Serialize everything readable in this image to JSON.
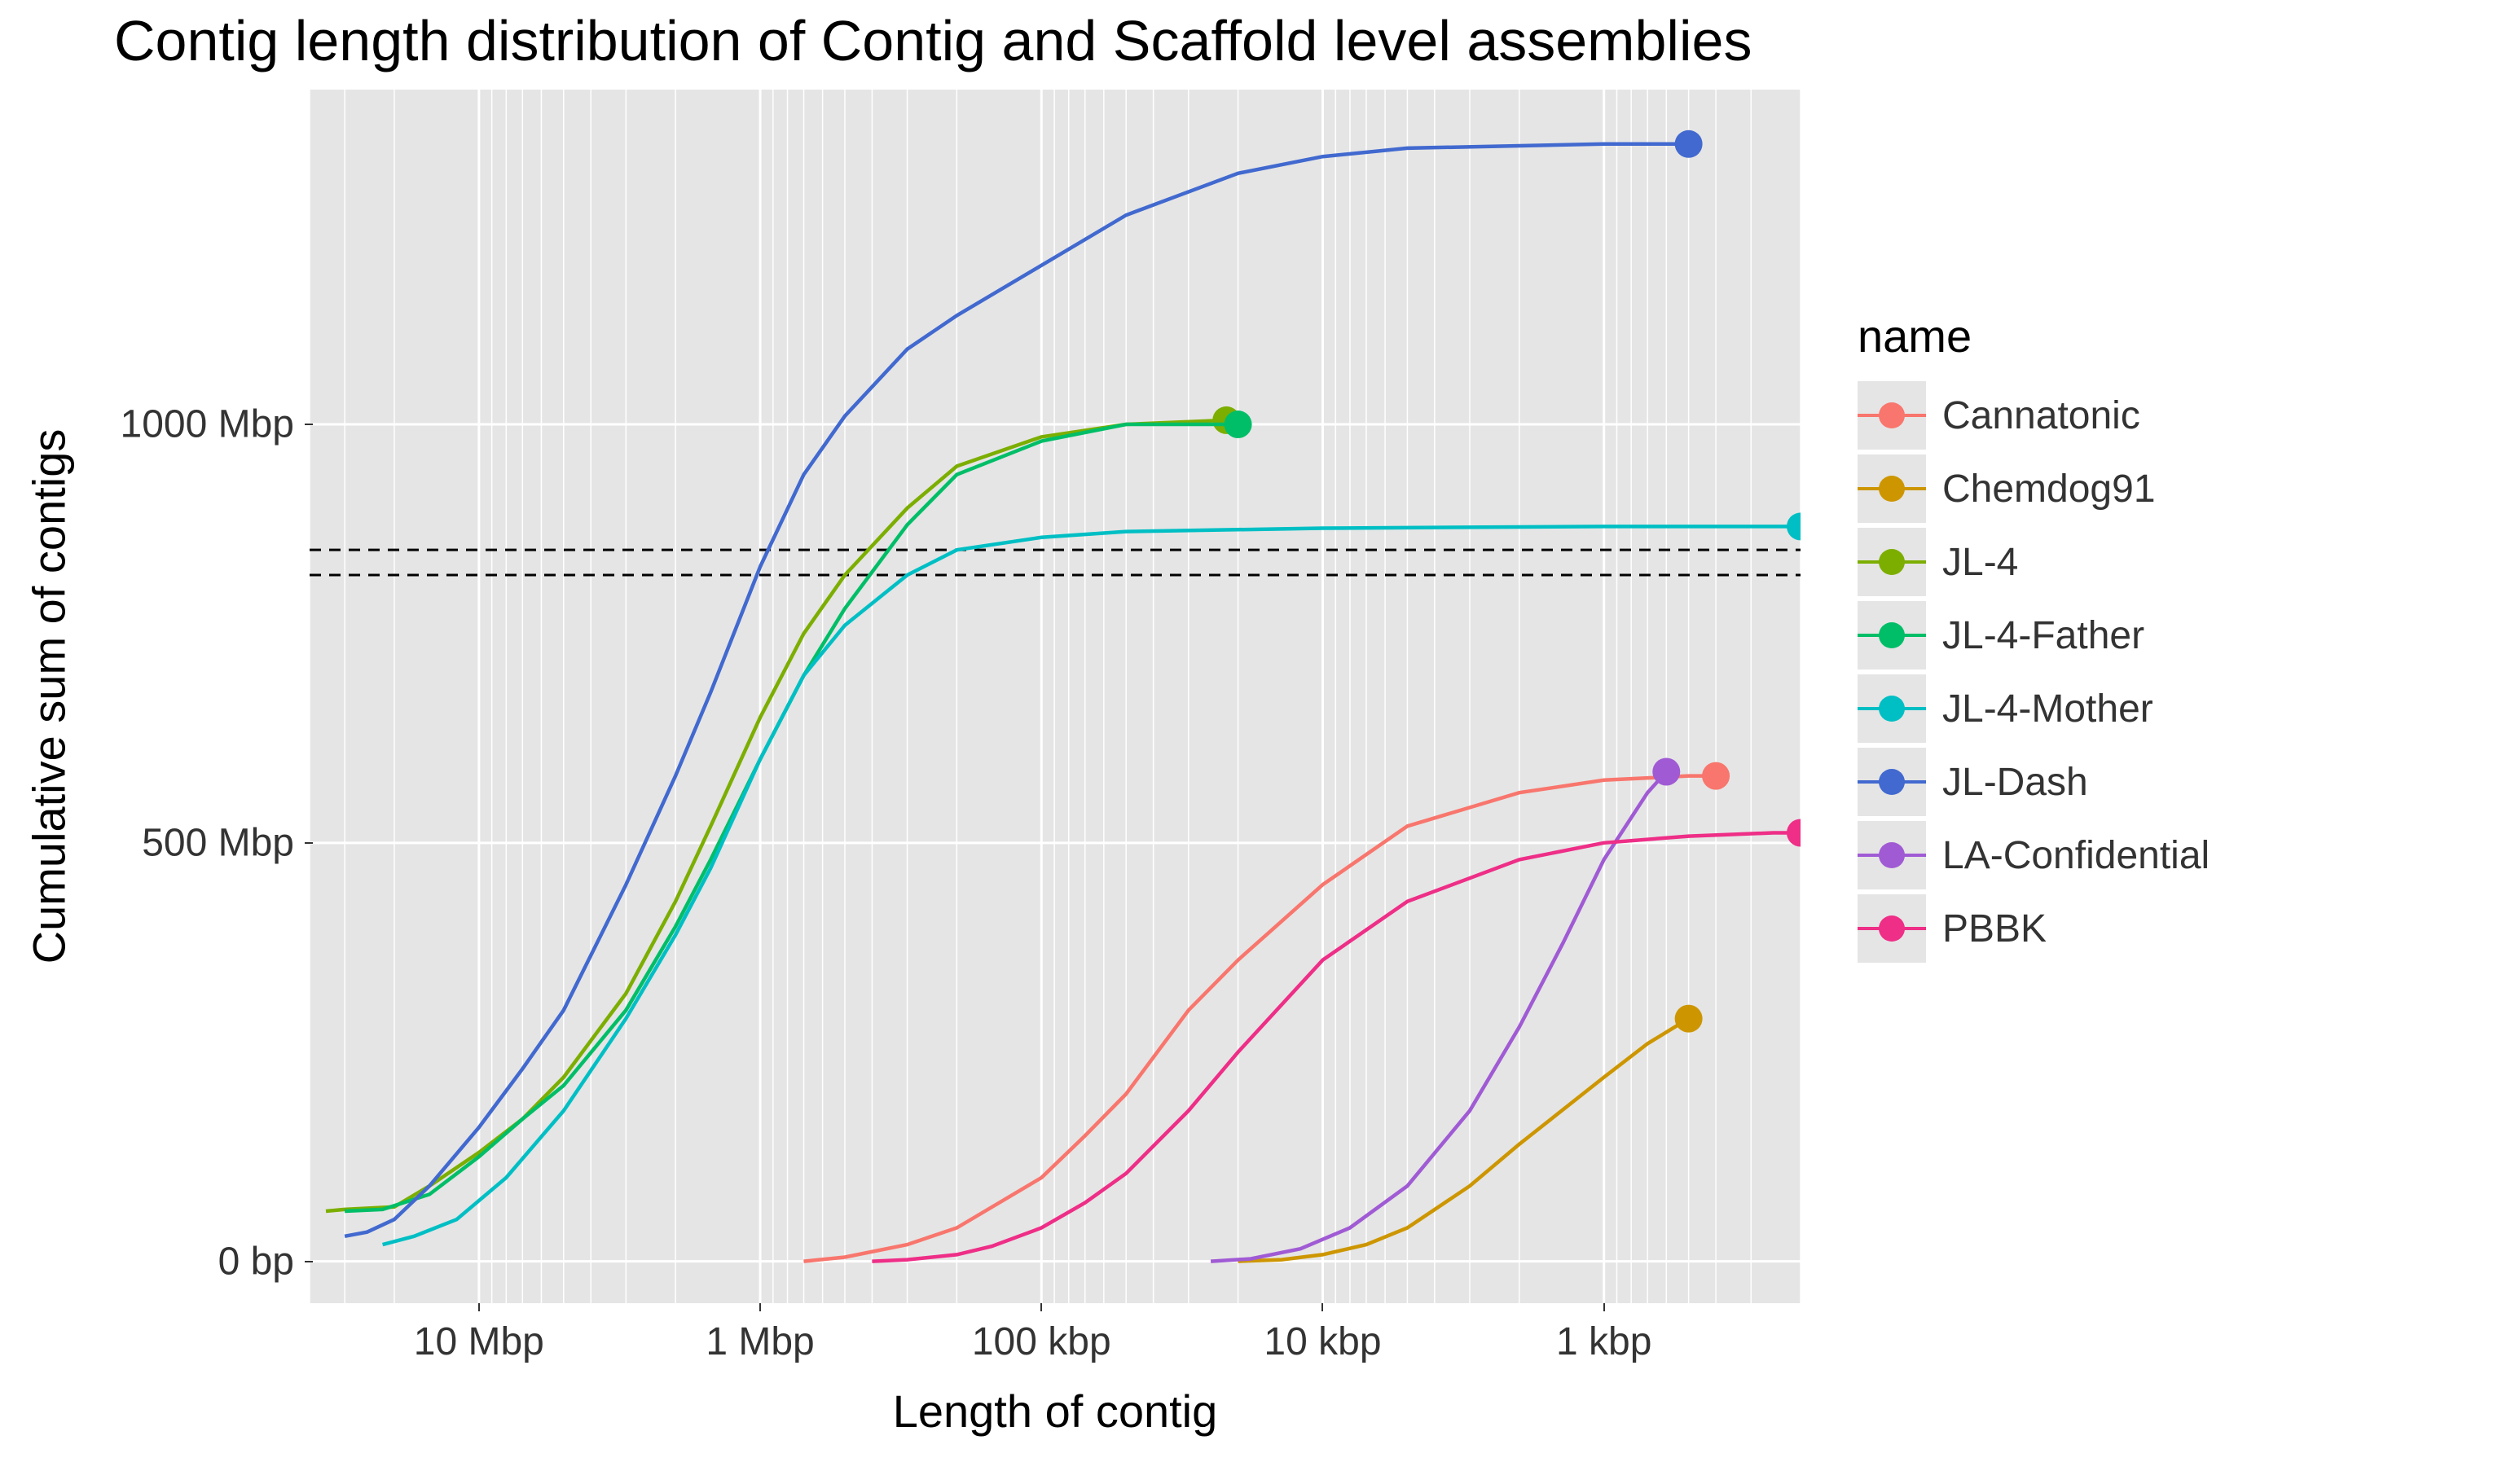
{
  "chart_data": {
    "type": "line",
    "title": "Contig length distribution of Contig and Scaffold level assemblies",
    "xlabel": "Length of contig",
    "ylabel": "Cumulative sum of contigs",
    "x_axis": {
      "scale": "log10_reversed",
      "ticks": [
        "10 Mbp",
        "1 Mbp",
        "100 kbp",
        "10 kbp",
        "1 kbp"
      ],
      "tick_values_bp": [
        10000000.0,
        1000000.0,
        100000.0,
        10000.0,
        1000.0
      ],
      "range_bp": [
        40000000.0,
        200
      ]
    },
    "y_axis": {
      "ticks": [
        "0 bp",
        "500 Mbp",
        "1000 Mbp"
      ],
      "tick_values_bp": [
        0,
        500000000.0,
        1000000000.0
      ],
      "range_bp": [
        -50000000.0,
        1400000000.0
      ]
    },
    "hlines_bp": [
      820000000.0,
      850000000.0
    ],
    "legend_title": "name",
    "series": [
      {
        "name": "Cannatonic",
        "color": "#f8766d",
        "end_dot": true,
        "x_bp": [
          700000.0,
          500000.0,
          300000.0,
          200000.0,
          100000.0,
          70000.0,
          50000.0,
          30000.0,
          20000.0,
          10000.0,
          5000.0,
          2000.0,
          1000.0,
          500,
          400
        ],
        "y_bp": [
          0,
          5000000.0,
          20000000.0,
          40000000.0,
          100000000.0,
          150000000.0,
          200000000.0,
          300000000.0,
          360000000.0,
          450000000.0,
          520000000.0,
          560000000.0,
          575000000.0,
          580000000.0,
          580000000.0
        ]
      },
      {
        "name": "Chemdog91",
        "color": "#cd9600",
        "end_dot": true,
        "x_bp": [
          20000.0,
          14000.0,
          10000.0,
          7000.0,
          5000.0,
          3000.0,
          2000.0,
          1000.0,
          700,
          500
        ],
        "y_bp": [
          0,
          2000000.0,
          8000000.0,
          20000000.0,
          40000000.0,
          90000000.0,
          140000000.0,
          220000000.0,
          260000000.0,
          290000000.0
        ]
      },
      {
        "name": "JL-4",
        "color": "#7cae00",
        "end_dot": true,
        "x_bp": [
          35000000.0,
          30000000.0,
          20000000.0,
          15000000.0,
          10000000.0,
          7000000.0,
          5000000.0,
          3000000.0,
          2000000.0,
          1500000.0,
          1000000.0,
          700000.0,
          500000.0,
          300000.0,
          200000.0,
          100000.0,
          50000.0,
          22000.0
        ],
        "y_bp": [
          60000000.0,
          62000000.0,
          65000000.0,
          90000000.0,
          130000000.0,
          170000000.0,
          220000000.0,
          320000000.0,
          430000000.0,
          520000000.0,
          650000000.0,
          750000000.0,
          820000000.0,
          900000000.0,
          950000000.0,
          985000000.0,
          1000000000.0,
          1005000000.0
        ]
      },
      {
        "name": "JL-4-Father",
        "color": "#00be67",
        "end_dot": true,
        "x_bp": [
          30000000.0,
          22000000.0,
          15000000.0,
          10000000.0,
          7000000.0,
          5000000.0,
          3000000.0,
          2000000.0,
          1500000.0,
          1000000.0,
          700000.0,
          500000.0,
          300000.0,
          200000.0,
          100000.0,
          50000.0,
          20000.0
        ],
        "y_bp": [
          60000000.0,
          62000000.0,
          80000000.0,
          125000000.0,
          170000000.0,
          210000000.0,
          300000000.0,
          400000000.0,
          480000000.0,
          600000000.0,
          700000000.0,
          780000000.0,
          880000000.0,
          940000000.0,
          980000000.0,
          1000000000.0,
          1000000000.0
        ]
      },
      {
        "name": "JL-4-Mother",
        "color": "#00bfc4",
        "end_dot": true,
        "x_bp": [
          22000000.0,
          17000000.0,
          12000000.0,
          8000000.0,
          5000000.0,
          3000000.0,
          2000000.0,
          1500000.0,
          1000000.0,
          700000.0,
          500000.0,
          300000.0,
          200000.0,
          100000.0,
          50000.0,
          10000.0,
          1000.0,
          300,
          200
        ],
        "y_bp": [
          20000000.0,
          30000000.0,
          50000000.0,
          100000000.0,
          180000000.0,
          290000000.0,
          390000000.0,
          470000000.0,
          600000000.0,
          700000000.0,
          760000000.0,
          820000000.0,
          850000000.0,
          865000000.0,
          872000000.0,
          876000000.0,
          878000000.0,
          878000000.0,
          878000000.0
        ]
      },
      {
        "name": "JL-Dash",
        "color": "#4169cf",
        "end_dot": true,
        "x_bp": [
          30000000.0,
          25000000.0,
          20000000.0,
          15000000.0,
          10000000.0,
          7000000.0,
          5000000.0,
          3000000.0,
          2000000.0,
          1500000.0,
          1000000.0,
          700000.0,
          500000.0,
          300000.0,
          200000.0,
          100000.0,
          50000.0,
          20000.0,
          10000.0,
          5000.0,
          1000.0,
          500
        ],
        "y_bp": [
          30000000.0,
          35000000.0,
          50000000.0,
          90000000.0,
          160000000.0,
          230000000.0,
          300000000.0,
          450000000.0,
          580000000.0,
          680000000.0,
          830000000.0,
          940000000.0,
          1010000000.0,
          1090000000.0,
          1130000000.0,
          1190000000.0,
          1250000000.0,
          1300000000.0,
          1320000000.0,
          1330000000.0,
          1335000000.0,
          1335000000.0
        ]
      },
      {
        "name": "LA-Confidential",
        "color": "#a05bd4",
        "end_dot": true,
        "x_bp": [
          25000.0,
          18000.0,
          12000.0,
          8000.0,
          5000.0,
          3000.0,
          2000.0,
          1400.0,
          1000.0,
          700,
          600
        ],
        "y_bp": [
          0,
          3000000.0,
          15000000.0,
          40000000.0,
          90000000.0,
          180000000.0,
          280000000.0,
          380000000.0,
          480000000.0,
          560000000.0,
          585000000.0
        ]
      },
      {
        "name": "PBBK",
        "color": "#ee2e87",
        "end_dot": true,
        "x_bp": [
          400000.0,
          300000.0,
          200000.0,
          150000.0,
          100000.0,
          70000.0,
          50000.0,
          30000.0,
          20000.0,
          10000.0,
          5000.0,
          2000.0,
          1000.0,
          500,
          250,
          200
        ],
        "y_bp": [
          0,
          2000000.0,
          8000000.0,
          18000000.0,
          40000000.0,
          70000000.0,
          105000000.0,
          180000000.0,
          250000000.0,
          360000000.0,
          430000000.0,
          480000000.0,
          500000000.0,
          508000000.0,
          512000000.0,
          512000000.0
        ]
      }
    ]
  }
}
